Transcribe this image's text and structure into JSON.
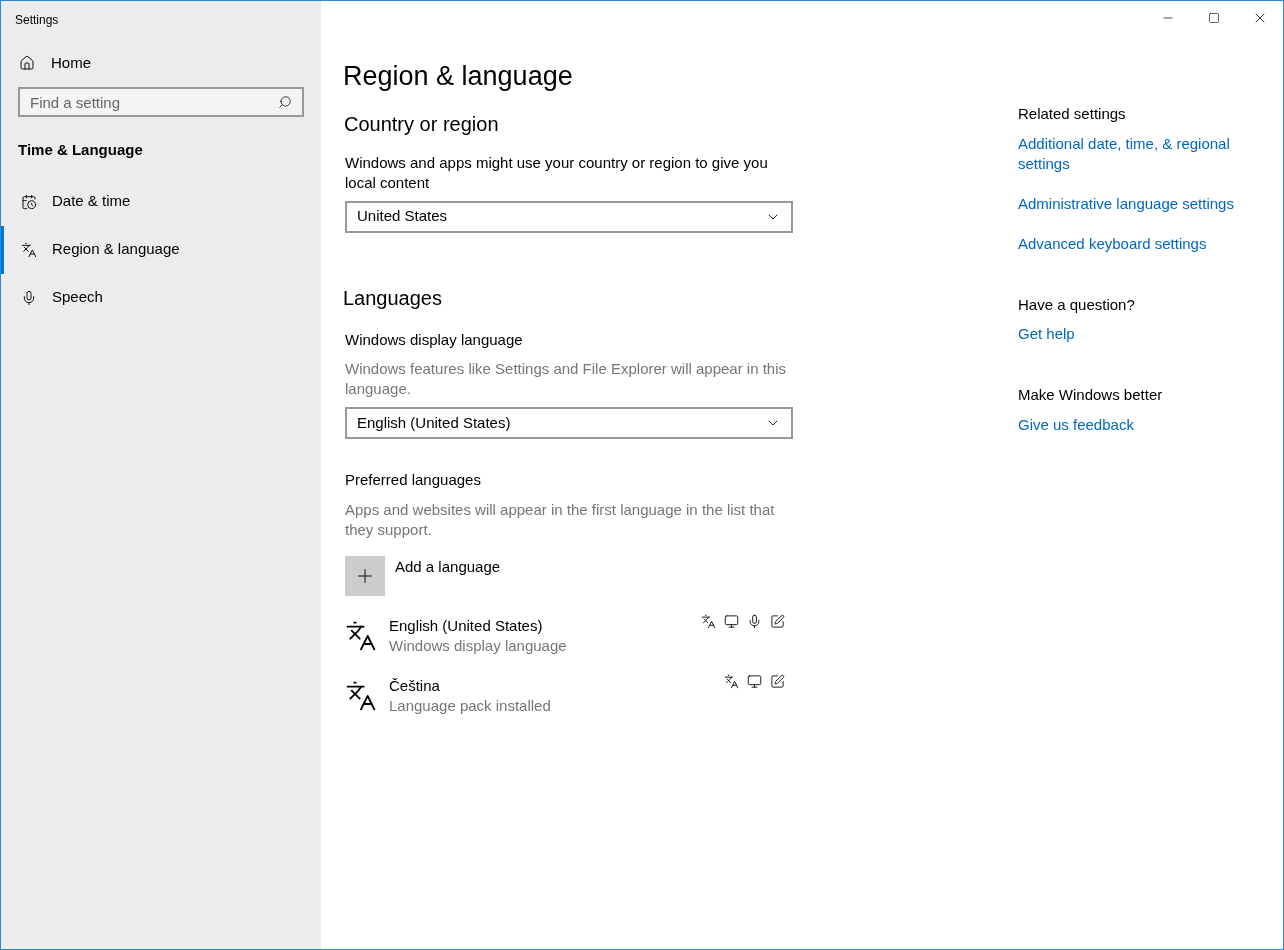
{
  "window": {
    "title": "Settings"
  },
  "sidebar": {
    "home": {
      "label": "Home",
      "kind": "home"
    },
    "search": {
      "placeholder": "Find a setting"
    },
    "section": "Time & Language",
    "items": [
      {
        "label": "Date & time",
        "kind": "calendar",
        "selected": false
      },
      {
        "label": "Region & language",
        "kind": "language",
        "selected": true
      },
      {
        "label": "Speech",
        "kind": "mic",
        "selected": false
      }
    ]
  },
  "page": {
    "title": "Region & language",
    "country": {
      "heading": "Country or region",
      "description": "Windows and apps might use your country or region to give you local content",
      "value": "United States"
    },
    "languages": {
      "heading": "Languages",
      "display_label": "Windows display language",
      "display_description": "Windows features like Settings and File Explorer will appear in this language.",
      "display_value": "English (United States)",
      "preferred_label": "Preferred languages",
      "preferred_description": "Apps and websites will appear in the first language in the list that they support.",
      "add_label": "Add a language",
      "list": [
        {
          "name": "English (United States)",
          "status": "Windows display language",
          "features": [
            {
              "kind": "language"
            },
            {
              "kind": "display"
            },
            {
              "kind": "speech"
            },
            {
              "kind": "handwriting"
            }
          ]
        },
        {
          "name": "Čeština",
          "status": "Language pack installed",
          "features": [
            {
              "kind": "language"
            },
            {
              "kind": "display"
            },
            {
              "kind": "handwriting"
            }
          ]
        }
      ]
    }
  },
  "related": [
    {
      "heading": "Related settings",
      "links": [
        "Additional date, time, & regional settings",
        "Administrative language settings",
        "Advanced keyboard settings"
      ]
    },
    {
      "heading": "Have a question?",
      "links": [
        "Get help"
      ]
    },
    {
      "heading": "Make Windows better",
      "links": [
        "Give us feedback"
      ]
    }
  ]
}
